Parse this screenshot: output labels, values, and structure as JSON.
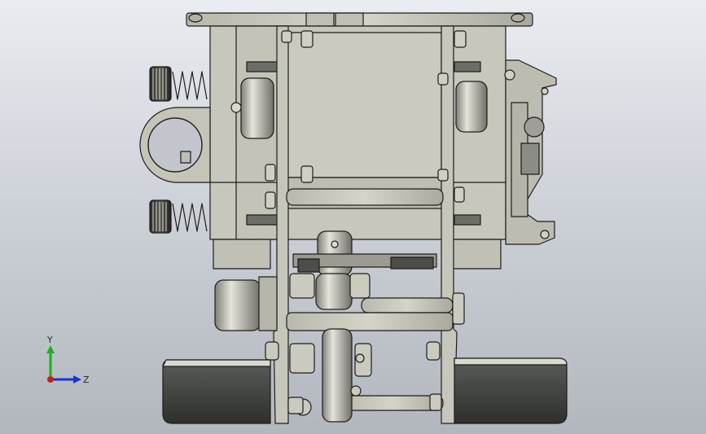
{
  "viewport": {
    "background_top": "#e9ecf0",
    "background_bottom": "#b2b6bd"
  },
  "colors": {
    "metal": "#c9c9bd",
    "metal_dark": "#8f8f86",
    "edge": "#1d1d1b",
    "rubber": "#3b3d3b",
    "axis_x": "#d21a1a",
    "axis_y": "#1ab21a",
    "axis_z": "#1a35d6"
  },
  "triad": {
    "y_label": "Y",
    "z_label": "Z"
  }
}
